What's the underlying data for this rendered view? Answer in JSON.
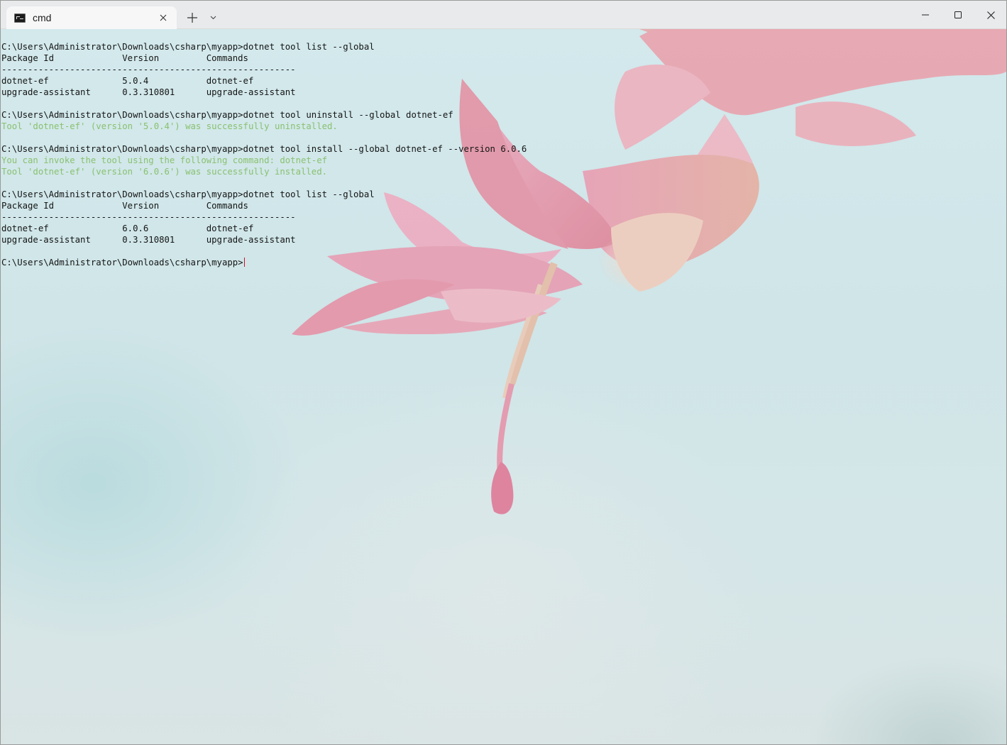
{
  "tab": {
    "title": "cmd",
    "icon": "command-prompt-icon"
  },
  "window_controls": {
    "minimize_icon": "minimize-icon",
    "maximize_icon": "maximize-icon",
    "close_icon": "close-icon"
  },
  "colors": {
    "success_text": "#8ac16f",
    "cursor": "#c8102e"
  },
  "terminal": {
    "lines": [
      {
        "text": "C:\\Users\\Administrator\\Downloads\\csharp\\myapp>dotnet tool list --global",
        "kind": "command"
      },
      {
        "text": "Package Id             Version         Commands",
        "kind": "output"
      },
      {
        "text": "--------------------------------------------------------",
        "kind": "output"
      },
      {
        "text": "dotnet-ef              5.0.4           dotnet-ef",
        "kind": "output"
      },
      {
        "text": "upgrade-assistant      0.3.310801      upgrade-assistant",
        "kind": "output"
      },
      {
        "text": "",
        "kind": "blank"
      },
      {
        "text": "C:\\Users\\Administrator\\Downloads\\csharp\\myapp>dotnet tool uninstall --global dotnet-ef",
        "kind": "command"
      },
      {
        "text": "Tool 'dotnet-ef' (version '5.0.4') was successfully uninstalled.",
        "kind": "success"
      },
      {
        "text": "",
        "kind": "blank"
      },
      {
        "text": "C:\\Users\\Administrator\\Downloads\\csharp\\myapp>dotnet tool install --global dotnet-ef --version 6.0.6",
        "kind": "command"
      },
      {
        "text": "You can invoke the tool using the following command: dotnet-ef",
        "kind": "success"
      },
      {
        "text": "Tool 'dotnet-ef' (version '6.0.6') was successfully installed.",
        "kind": "success"
      },
      {
        "text": "",
        "kind": "blank"
      },
      {
        "text": "C:\\Users\\Administrator\\Downloads\\csharp\\myapp>dotnet tool list --global",
        "kind": "command"
      },
      {
        "text": "Package Id             Version         Commands",
        "kind": "output"
      },
      {
        "text": "--------------------------------------------------------",
        "kind": "output"
      },
      {
        "text": "dotnet-ef              6.0.6           dotnet-ef",
        "kind": "output"
      },
      {
        "text": "upgrade-assistant      0.3.310801      upgrade-assistant",
        "kind": "output"
      },
      {
        "text": "",
        "kind": "blank"
      }
    ],
    "prompt": "C:\\Users\\Administrator\\Downloads\\csharp\\myapp>"
  }
}
